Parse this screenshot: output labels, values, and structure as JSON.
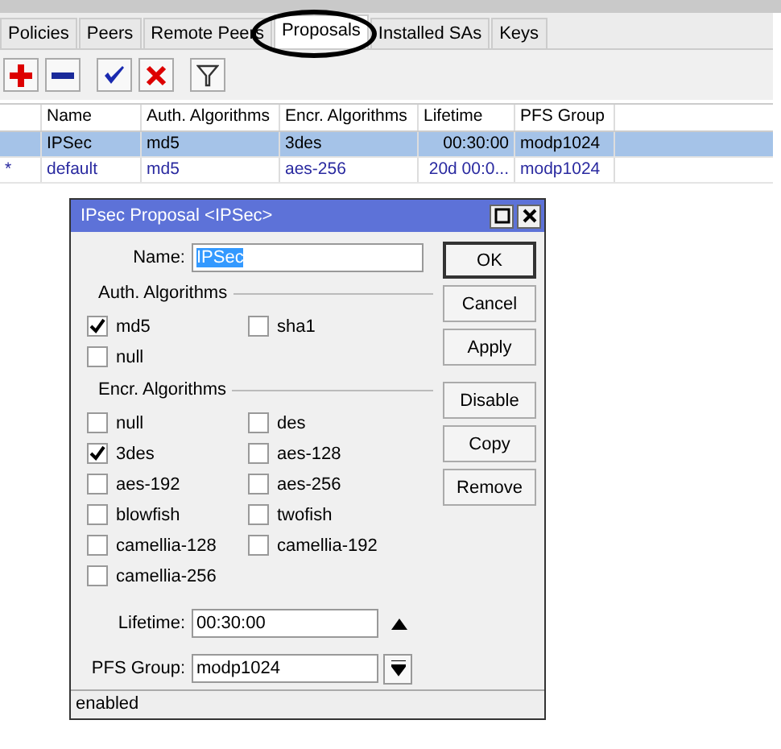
{
  "tabs": [
    {
      "label": "Policies",
      "selected": false
    },
    {
      "label": "Peers",
      "selected": false
    },
    {
      "label": "Remote Peers",
      "selected": false
    },
    {
      "label": "Proposals",
      "selected": true
    },
    {
      "label": "Installed SAs",
      "selected": false
    },
    {
      "label": "Keys",
      "selected": false
    }
  ],
  "toolbar": [
    {
      "kind": "add"
    },
    {
      "kind": "remove"
    },
    {
      "kind": "enable"
    },
    {
      "kind": "disable"
    },
    {
      "kind": "filter"
    }
  ],
  "table": {
    "columns": [
      "Name",
      "Auth. Algorithms",
      "Encr. Algorithms",
      "Lifetime",
      "PFS Group"
    ],
    "rows": [
      {
        "flag": "",
        "selected": true,
        "dynamic": false,
        "cells": [
          "IPSec",
          "md5",
          "3des",
          "00:30:00",
          "modp1024"
        ]
      },
      {
        "flag": "*",
        "selected": false,
        "dynamic": true,
        "cells": [
          "default",
          "md5",
          "aes-256",
          "20d 00:0...",
          "modp1024"
        ]
      }
    ]
  },
  "dialog": {
    "title": "IPsec Proposal <IPSec>",
    "name_label": "Name:",
    "name_value": "IPSec",
    "auth_group": "Auth. Algorithms",
    "auth": [
      {
        "label": "md5",
        "checked": true
      },
      {
        "label": "sha1",
        "checked": false
      },
      {
        "label": "null",
        "checked": false
      }
    ],
    "encr_group": "Encr. Algorithms",
    "encr": [
      {
        "label": "null",
        "checked": false
      },
      {
        "label": "des",
        "checked": false
      },
      {
        "label": "3des",
        "checked": true
      },
      {
        "label": "aes-128",
        "checked": false
      },
      {
        "label": "aes-192",
        "checked": false
      },
      {
        "label": "aes-256",
        "checked": false
      },
      {
        "label": "blowfish",
        "checked": false
      },
      {
        "label": "twofish",
        "checked": false
      },
      {
        "label": "camellia-128",
        "checked": false
      },
      {
        "label": "camellia-192",
        "checked": false
      },
      {
        "label": "camellia-256",
        "checked": false
      }
    ],
    "lifetime_label": "Lifetime:",
    "lifetime_value": "00:30:00",
    "pfs_label": "PFS Group:",
    "pfs_value": "modp1024",
    "buttons": [
      [
        "OK",
        "Cancel",
        "Apply"
      ],
      [
        "Disable",
        "Copy",
        "Remove"
      ]
    ],
    "status": "enabled"
  }
}
